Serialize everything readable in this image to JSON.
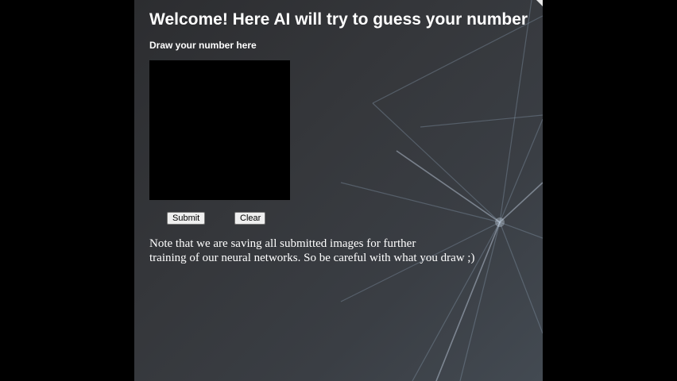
{
  "page": {
    "title": "Welcome! Here AI will try to guess your number",
    "draw_label": "Draw your number here"
  },
  "buttons": {
    "submit_label": "Submit",
    "clear_label": "Clear"
  },
  "note": {
    "line1": "Note that we are saving all submitted images for further",
    "line2": "training of our neural networks. So be careful with what you draw ;)"
  },
  "colors": {
    "outer_background": "#000000",
    "panel_background": "#35373b",
    "text": "#ffffff",
    "drawing_canvas": "#000000"
  }
}
